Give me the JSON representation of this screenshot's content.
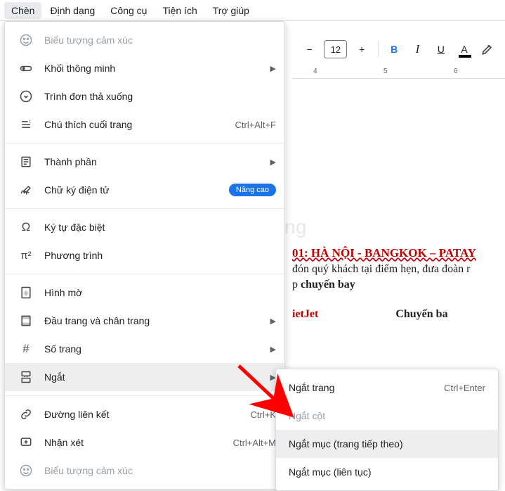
{
  "menubar": {
    "items": [
      {
        "label": "Chèn",
        "active": true
      },
      {
        "label": "Định dạng"
      },
      {
        "label": "Công cụ"
      },
      {
        "label": "Tiện ích"
      },
      {
        "label": "Trợ giúp"
      }
    ]
  },
  "toolbar": {
    "font_size": "12",
    "bold": "B",
    "italic": "I",
    "underline": "U",
    "text_color": "A"
  },
  "ruler": {
    "marks": [
      "4",
      "5",
      "6"
    ]
  },
  "menu": {
    "emoji": "Biểu tượng cảm xúc",
    "smart_chips": "Khối thông minh",
    "dropdown": "Trình đơn thả xuống",
    "footnote": "Chú thích cuối trang",
    "footnote_sc": "Ctrl+Alt+F",
    "building_blocks": "Thành phần",
    "esignature": "Chữ ký điện tử",
    "esignature_badge": "Nâng cao",
    "special_chars": "Ký tự đặc biệt",
    "equation": "Phương trình",
    "watermark": "Hình mờ",
    "headers_footers": "Đầu trang và chân trang",
    "page_numbers": "Số trang",
    "break": "Ngắt",
    "link": "Đường liên kết",
    "link_sc": "Ctrl+K",
    "comment": "Nhận xét",
    "comment_sc": "Ctrl+Alt+M",
    "emoji2": "Biểu tượng cảm xúc"
  },
  "submenu": {
    "page_break": "Ngắt trang",
    "page_break_sc": "Ctrl+Enter",
    "column_break": "Ngắt cột",
    "section_next": "Ngắt mục (trang tiếp theo)",
    "section_cont": "Ngắt mục (liên tục)"
  },
  "document": {
    "title": "01: HÀ NỘI - BANGKOK – PATAY",
    "line1_a": "đón quý khách tại điểm hẹn, đưa đoàn r",
    "line1_b": "p ",
    "line1_bold": "chuyến bay",
    "th1": "ietJet",
    "th2": "Chuyến ba"
  },
  "watermark": "uantrimang"
}
